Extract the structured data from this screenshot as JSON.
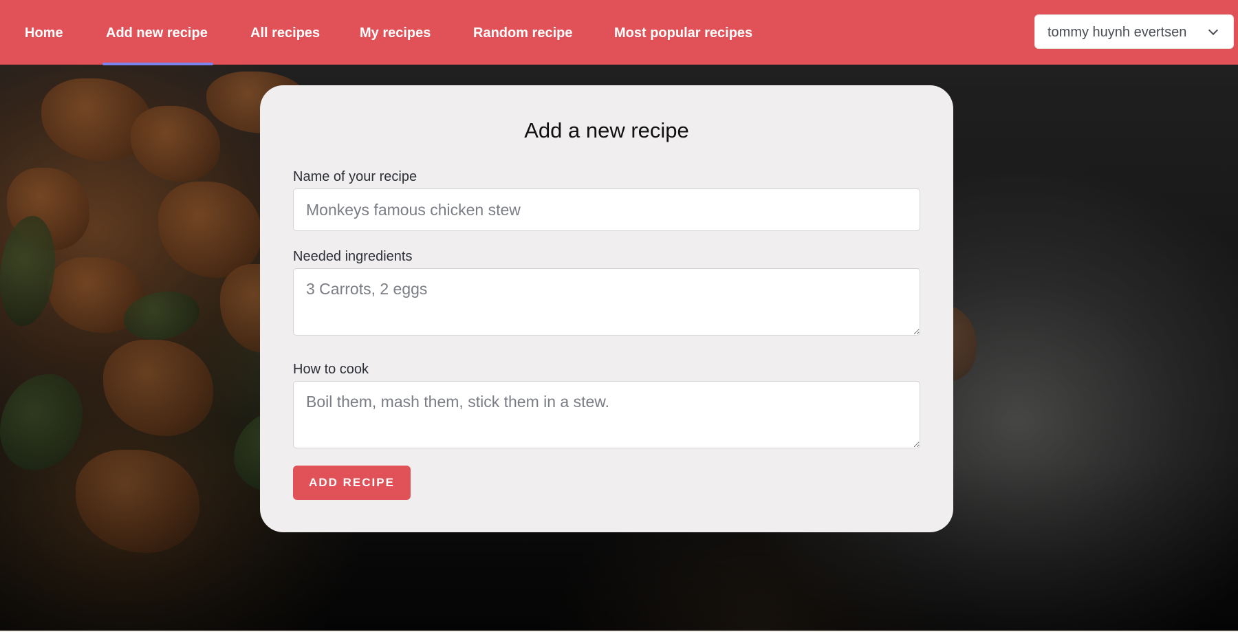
{
  "nav": {
    "items": [
      {
        "label": "Home",
        "active": false
      },
      {
        "label": "Add new recipe",
        "active": true
      },
      {
        "label": "All recipes",
        "active": false
      },
      {
        "label": "My recipes",
        "active": false
      },
      {
        "label": "Random recipe",
        "active": false
      },
      {
        "label": "Most popular recipes",
        "active": false
      }
    ],
    "user_menu": {
      "selected": "tommy huynh evertsen",
      "icon": "chevron-down-icon"
    }
  },
  "form": {
    "title": "Add a new recipe",
    "name_field": {
      "label": "Name of your recipe",
      "value": "",
      "placeholder": "Monkeys famous chicken stew"
    },
    "ingredients_field": {
      "label": "Needed ingredients",
      "value": "",
      "placeholder": "3 Carrots, 2 eggs"
    },
    "instructions_field": {
      "label": "How to cook",
      "value": "",
      "placeholder": "Boil them, mash them, stick them in a stew."
    },
    "submit_label": "ADD RECIPE"
  },
  "colors": {
    "brand": "#e05257",
    "active_tab_indicator": "#7c83f0",
    "card_background": "#f0eeef"
  }
}
